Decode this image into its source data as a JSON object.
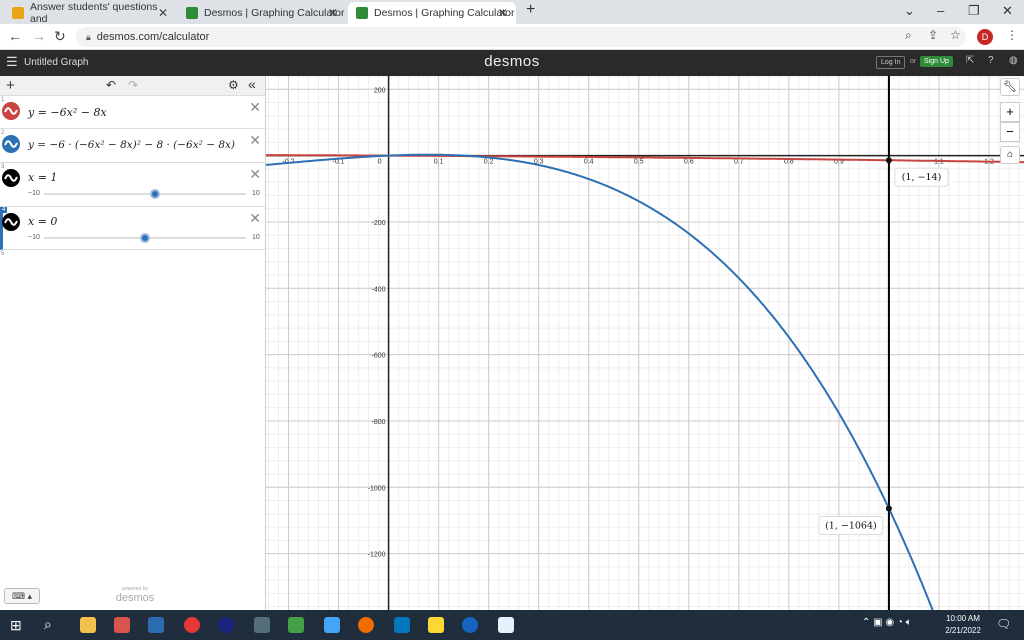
{
  "browser": {
    "tabs": [
      {
        "title": "Answer students' questions and",
        "active": false,
        "color": "#e8a317"
      },
      {
        "title": "Desmos | Graphing Calculator",
        "active": false,
        "color": "#2f8a3a"
      },
      {
        "title": "Desmos | Graphing Calculator",
        "active": true,
        "color": "#2f8a3a"
      }
    ],
    "url": "desmos.com/calculator",
    "profile_initial": "D"
  },
  "desmos": {
    "brand": "desmos",
    "graph_title": "Untitled Graph",
    "login": "Log In",
    "or": "or",
    "signup": "Sign Up",
    "powered_by": "powered by",
    "powered_brand": "desmos"
  },
  "expressions": [
    {
      "num": "1",
      "latex": "y = −6x² − 8x",
      "color": "#c74440"
    },
    {
      "num": "2",
      "latex": "y = −6 · (−6x² − 8x)² − 8 · (−6x² − 8x)",
      "color": "#2d70b3"
    },
    {
      "num": "3",
      "latex": "x = 1",
      "color": "#000000",
      "slider": {
        "min": "−10",
        "max": "10",
        "value": 1
      }
    },
    {
      "num": "4",
      "latex": "x = 0",
      "color": "#000000",
      "slider": {
        "min": "−10",
        "max": "10",
        "value": 0
      }
    },
    {
      "num": "5",
      "latex": ""
    }
  ],
  "graph": {
    "x_ticks": [
      "-0.2",
      "-0.1",
      "0",
      "0.1",
      "0.2",
      "0.3",
      "0.4",
      "0.5",
      "0.6",
      "0.7",
      "0.8",
      "0.9",
      "1",
      "1.1",
      "1.2"
    ],
    "y_ticks": [
      "200",
      "-200",
      "-400",
      "-600",
      "-800",
      "-1000",
      "-1200"
    ],
    "points": [
      {
        "label": "(1, −14)",
        "x": 1,
        "y": -14
      },
      {
        "label": "(1, −1064)",
        "x": 1,
        "y": -1064
      }
    ],
    "xlim": [
      -0.245,
      1.27
    ],
    "ylim": [
      -1370,
      240
    ]
  },
  "taskbar": {
    "time": "10:00 AM",
    "date": "2/21/2022"
  }
}
